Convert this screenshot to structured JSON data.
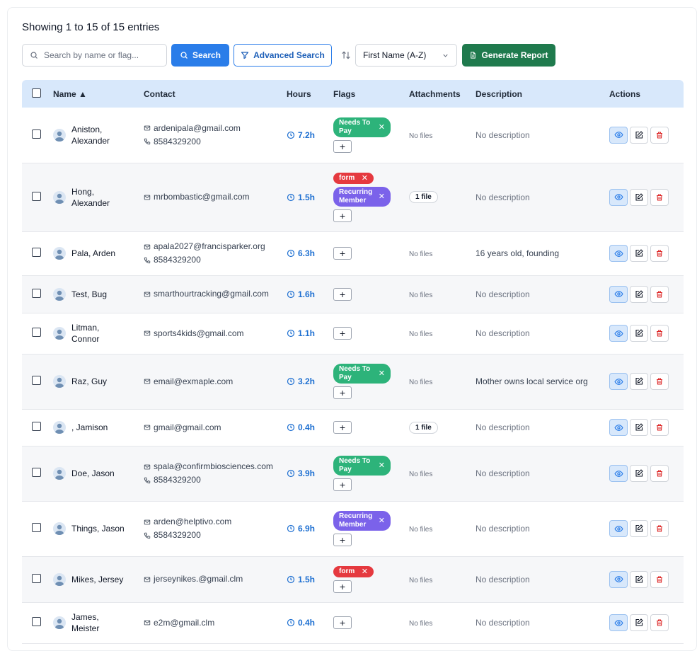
{
  "summary": "Showing 1 to 15 of 15 entries",
  "toolbar": {
    "search_placeholder": "Search by name or flag...",
    "search_label": "Search",
    "advanced_label": "Advanced Search",
    "sort_value": "First Name (A-Z)",
    "report_label": "Generate Report"
  },
  "columns": {
    "name": "Name ▲",
    "contact": "Contact",
    "hours": "Hours",
    "flags": "Flags",
    "attachments": "Attachments",
    "description": "Description",
    "actions": "Actions"
  },
  "colors": {
    "primary": "#2a7de9",
    "report": "#1f7a4d",
    "tag_green": "#2db37a",
    "tag_purple": "#7b62ea",
    "tag_red": "#e5393f"
  },
  "rows": [
    {
      "name1": "Aniston,",
      "name2": "Alexander",
      "email": "ardenipala@gmail.com",
      "phone": "8584329200",
      "hours": "7.2h",
      "flags": [
        {
          "label1": "Needs To",
          "label2": "Pay",
          "color": "green"
        }
      ],
      "attachments": "No files",
      "description": "No description"
    },
    {
      "name1": "Hong,",
      "name2": "Alexander",
      "email": "mrbombastic@gmail.com",
      "phone": "",
      "hours": "1.5h",
      "flags": [
        {
          "label1": "form",
          "label2": "",
          "color": "red"
        },
        {
          "label1": "Recurring",
          "label2": "Member",
          "color": "purple"
        }
      ],
      "attachments": "1 file",
      "description": "No description"
    },
    {
      "name1": "Pala, Arden",
      "name2": "",
      "email": "apala2027@francisparker.org",
      "phone": "8584329200",
      "hours": "6.3h",
      "flags": [],
      "attachments": "No files",
      "description": "16 years old, founding"
    },
    {
      "name1": "Test, Bug",
      "name2": "",
      "email": "smarthourtracking@gmail.com",
      "phone": "",
      "hours": "1.6h",
      "flags": [],
      "attachments": "No files",
      "description": "No description"
    },
    {
      "name1": "Litman,",
      "name2": "Connor",
      "email": "sports4kids@gmail.com",
      "phone": "",
      "hours": "1.1h",
      "flags": [],
      "attachments": "No files",
      "description": "No description"
    },
    {
      "name1": "Raz, Guy",
      "name2": "",
      "email": "email@exmaple.com",
      "phone": "",
      "hours": "3.2h",
      "flags": [
        {
          "label1": "Needs To",
          "label2": "Pay",
          "color": "green"
        }
      ],
      "attachments": "No files",
      "description": "Mother owns local service org"
    },
    {
      "name1": ", Jamison",
      "name2": "",
      "email": "gmail@gmail.com",
      "phone": "",
      "hours": "0.4h",
      "flags": [],
      "attachments": "1 file",
      "description": "No description"
    },
    {
      "name1": "Doe, Jason",
      "name2": "",
      "email": "spala@confirmbiosciences.com",
      "phone": "8584329200",
      "hours": "3.9h",
      "flags": [
        {
          "label1": "Needs To",
          "label2": "Pay",
          "color": "green"
        }
      ],
      "attachments": "No files",
      "description": "No description"
    },
    {
      "name1": "Things, Jason",
      "name2": "",
      "email": "arden@helptivo.com",
      "phone": "8584329200",
      "hours": "6.9h",
      "flags": [
        {
          "label1": "Recurring",
          "label2": "Member",
          "color": "purple"
        }
      ],
      "attachments": "No files",
      "description": "No description"
    },
    {
      "name1": "Mikes, Jersey",
      "name2": "",
      "email": "jerseynikes.@gmail.clm",
      "phone": "",
      "hours": "1.5h",
      "flags": [
        {
          "label1": "form",
          "label2": "",
          "color": "red"
        }
      ],
      "attachments": "No files",
      "description": "No description"
    },
    {
      "name1": "James,",
      "name2": "Meister",
      "email": "e2m@gmail.clm",
      "phone": "",
      "hours": "0.4h",
      "flags": [],
      "attachments": "No files",
      "description": "No description"
    }
  ]
}
